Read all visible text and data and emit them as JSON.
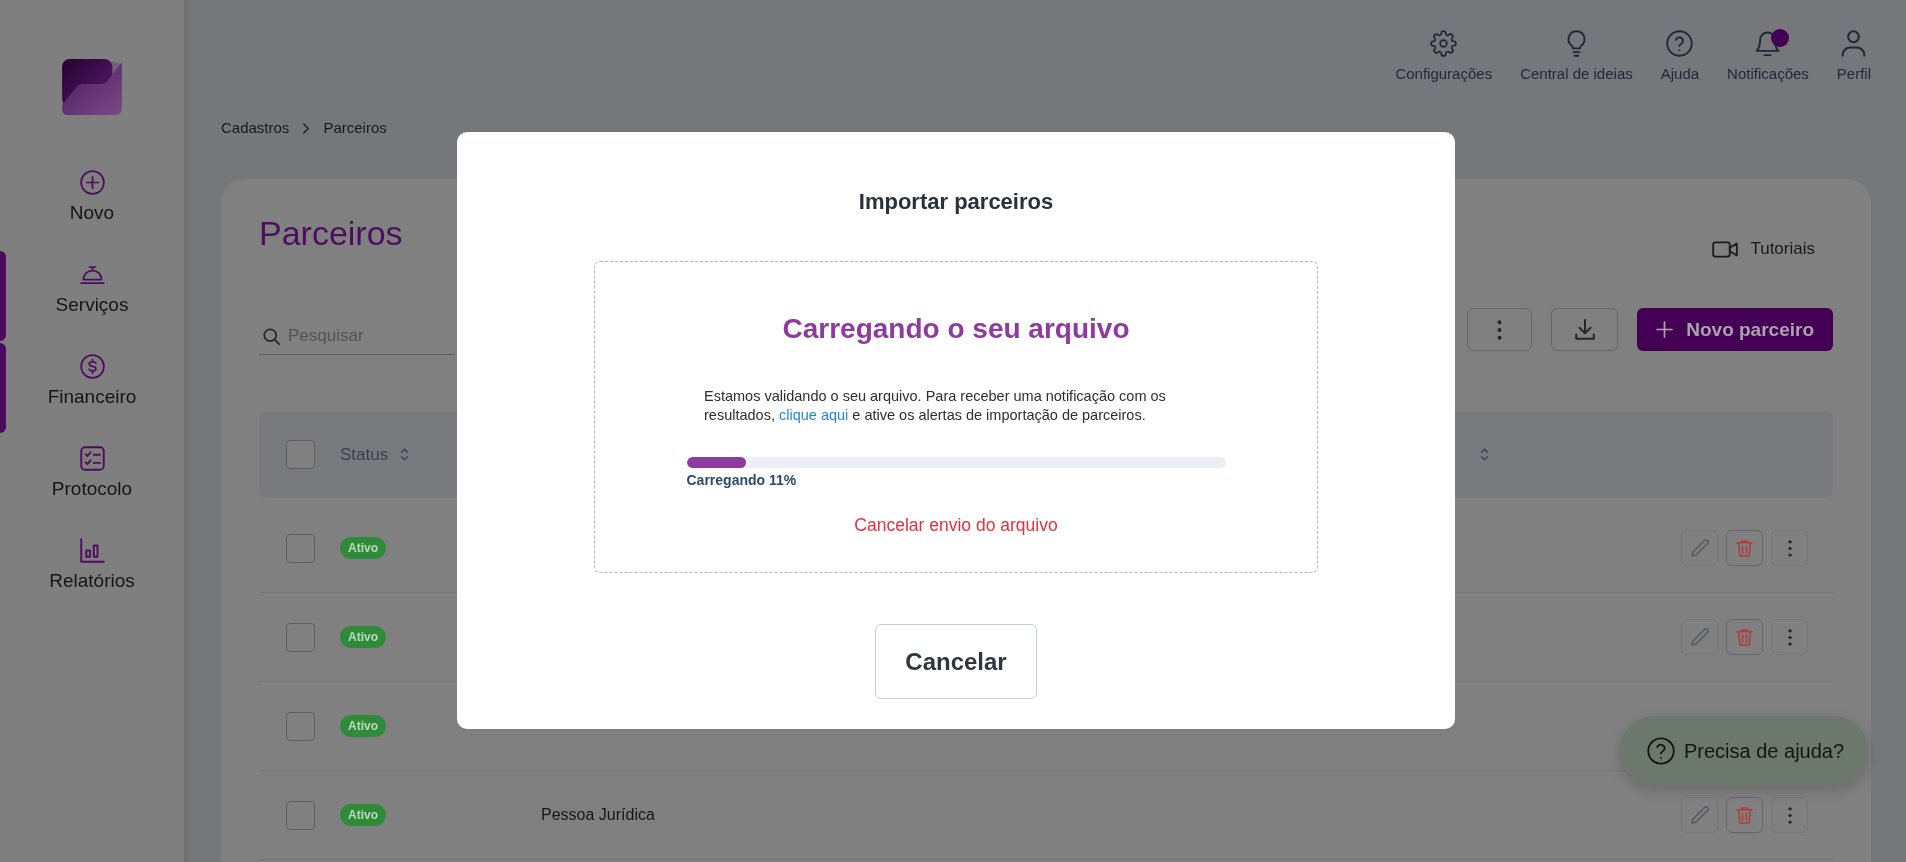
{
  "sidebar": {
    "items": [
      {
        "label": "Novo",
        "selected": false
      },
      {
        "label": "Serviços",
        "selected": true
      },
      {
        "label": "Financeiro",
        "selected": true
      },
      {
        "label": "Protocolo",
        "selected": false
      },
      {
        "label": "Relatórios",
        "selected": false
      }
    ]
  },
  "top_bar": {
    "items": [
      {
        "label": "Configurações",
        "unread": false
      },
      {
        "label": "Central de ideias",
        "unread": false
      },
      {
        "label": "Ajuda",
        "unread": false
      },
      {
        "label": "Notificações",
        "unread": true
      },
      {
        "label": "Perfil",
        "unread": false
      }
    ]
  },
  "breadcrumb": [
    {
      "label": "Cadastros"
    },
    {
      "label": "Parceiros"
    }
  ],
  "page": {
    "title": "Parceiros",
    "tutorials": "Tutoriais",
    "search": {
      "placeholder": "Pesquisar"
    },
    "new_button": "Novo parceiro"
  },
  "table": {
    "header_checkbox": {
      "checked": false
    },
    "columns": [
      {
        "label": "Status",
        "sortable": true
      },
      {
        "sortable": true
      }
    ],
    "rows": [
      {
        "checked": false,
        "status": "Ativo",
        "actions": true
      },
      {
        "checked": false,
        "status": "Ativo",
        "actions": true
      },
      {
        "checked": false,
        "status": "Ativo",
        "actions": false
      },
      {
        "checked": false,
        "status": "Ativo",
        "actions": true,
        "column_3": "Pessoa Jurídica"
      }
    ]
  },
  "modal": {
    "title": "Importar parceiros",
    "heading": "Carregando o seu arquivo",
    "message_before": "Estamos validando o seu arquivo. Para receber uma notificação com os resultados, ",
    "link": "clique aqui",
    "message_after": " e ative os alertas de importação de parceiros.",
    "progress": {
      "level": 0.11,
      "label": "Carregando 11%"
    },
    "cancel_upload": "Cancelar envio do arquivo",
    "cancel_button": "Cancelar"
  },
  "help_button": {
    "label": "Precisa de ajuda?"
  }
}
